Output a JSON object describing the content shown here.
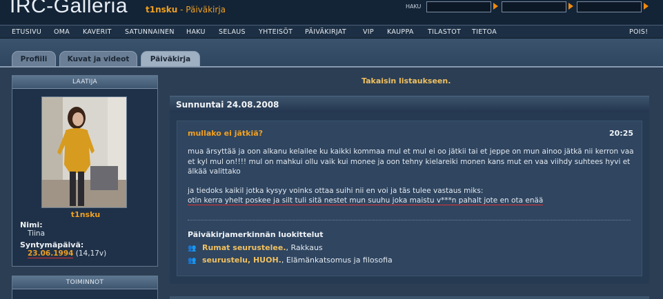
{
  "header": {
    "logo": "IRC-Galleria",
    "username": "t1nsku",
    "separator": " - ",
    "section": "Päiväkirja",
    "search_label": "HAKU",
    "search_inputs": [
      "",
      "",
      ""
    ]
  },
  "nav": {
    "items": [
      "ETUSIVU",
      "OMA",
      "KAVERIT",
      "SATUNNAINEN",
      "HAKU",
      "SELAUS",
      "YHTEISÖT",
      "PÄIVÄKIRJAT",
      "VIP",
      "KAUPPA",
      "TILASTOT",
      "TIETOA"
    ],
    "logout": "POIS!"
  },
  "tabs": [
    {
      "label": "Profiili",
      "active": false
    },
    {
      "label": "Kuvat ja videot",
      "active": false
    },
    {
      "label": "Päiväkirja",
      "active": true
    }
  ],
  "author_box": {
    "title": "LAATIJA",
    "nickname": "t1nsku",
    "name_label": "Nimi:",
    "name_value": "Tiina",
    "birthday_label": "Syntymäpäivä:",
    "birthday_value": "23.06.1994",
    "age": "(14,17v)"
  },
  "actions_box": {
    "title": "TOIMINNOT"
  },
  "main": {
    "back_link": "Takaisin listaukseen.",
    "date": "Sunnuntai 24.08.2008",
    "entry": {
      "title": "mullako ei jätkiä?",
      "time": "20:25",
      "paragraph1": "mua ärsyttää ja oon alkanu kelailee ku kaikki kommaa mul et mul ei oo jätkii tai et jeppe on mun ainoo jätkä nii kerron vaa et kyl mul on!!!! mul on mahkui ollu vaik kui monee ja oon tehny kielareiki monen kans mut en vaa viihdy suhtees hyvi et älkää valittako",
      "paragraph2_line1": "ja tiedoks kaikil jotka kysyy voinks ottaa suihi nii en voi ja täs tulee vastaus miks:",
      "paragraph2_line2": "otin kerra yhelt poskee ja silt tuli sitä nestet mun suuhu joka maistu v***n pahalt jote en ota enää"
    },
    "categories": {
      "title": "Päiväkirjamerkinnän luokittelut",
      "items": [
        {
          "main": "Rumat seurustelee.",
          "rest": ", Rakkaus"
        },
        {
          "main": "seurustelu, HUOH.",
          "rest": ", Elämänkatsomus ja filosofia"
        }
      ]
    }
  }
}
